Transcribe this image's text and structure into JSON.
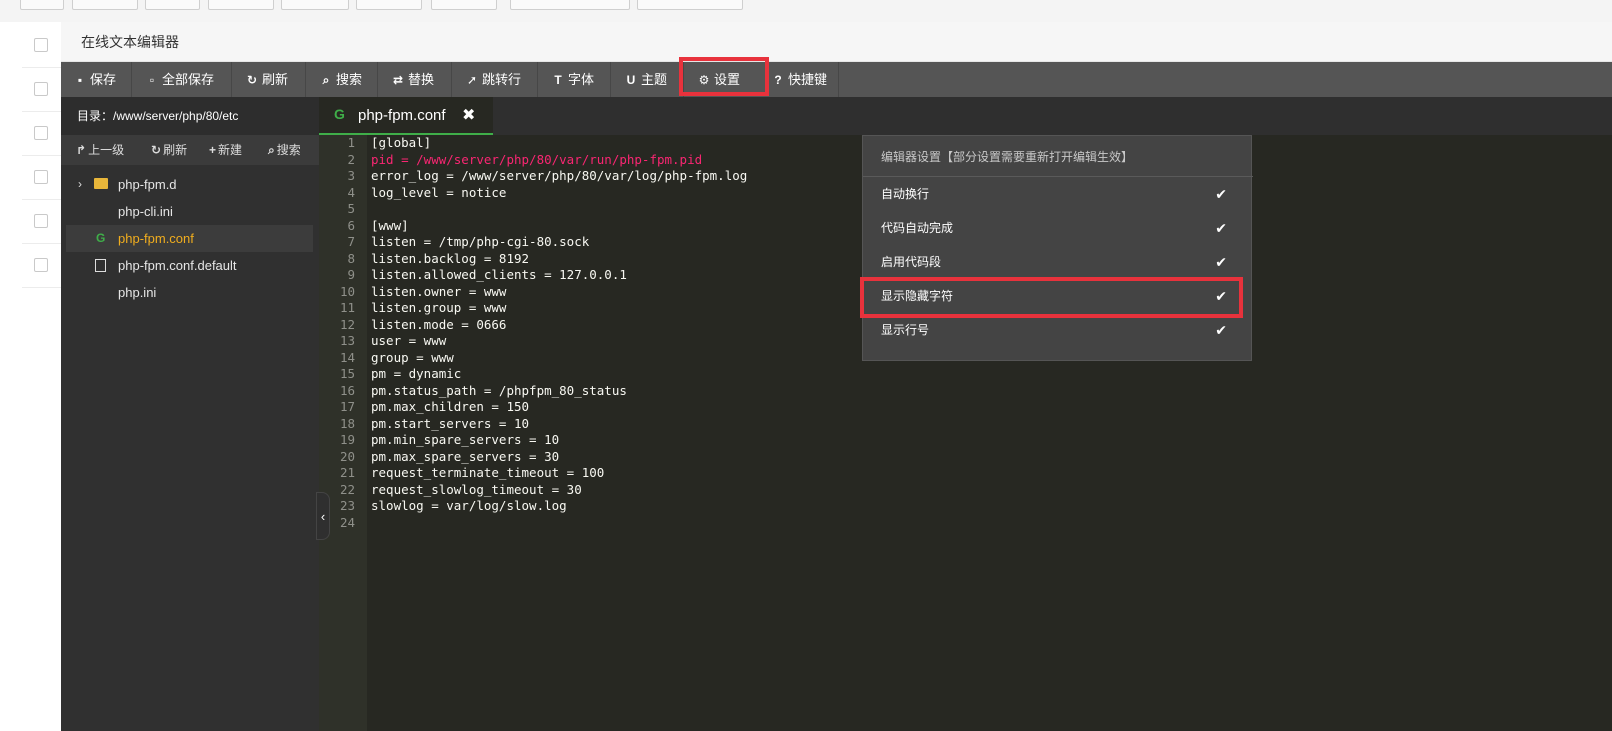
{
  "dialog": {
    "title": "在线文本编辑器"
  },
  "toolbar": {
    "items": [
      {
        "label": "保存",
        "icon": "save-icon",
        "glyph": "▪"
      },
      {
        "label": "全部保存",
        "icon": "save-all-icon",
        "glyph": "▫"
      },
      {
        "label": "刷新",
        "icon": "refresh-icon",
        "glyph": "↻"
      },
      {
        "label": "搜索",
        "icon": "search-icon",
        "glyph": "⌕"
      },
      {
        "label": "替换",
        "icon": "replace-icon",
        "glyph": "⇄"
      },
      {
        "label": "跳转行",
        "icon": "jump-icon",
        "glyph": "➚"
      },
      {
        "label": "字体",
        "icon": "font-icon",
        "glyph": "T"
      },
      {
        "label": "主题",
        "icon": "theme-icon",
        "glyph": "U"
      },
      {
        "label": "设置",
        "icon": "gear-icon",
        "glyph": "⚙"
      },
      {
        "label": "快捷键",
        "icon": "help-icon",
        "glyph": "?"
      }
    ]
  },
  "sidebar": {
    "path": "目录：/www/server/php/80/etc",
    "actions": [
      {
        "label": "上一级",
        "glyph": "↱"
      },
      {
        "label": "刷新",
        "glyph": "↻"
      },
      {
        "label": "新建",
        "glyph": "+"
      },
      {
        "label": "搜索",
        "glyph": "⌕"
      }
    ],
    "files": [
      {
        "name": "php-fpm.d",
        "type": "folder"
      },
      {
        "name": "php-cli.ini",
        "type": "file"
      },
      {
        "name": "php-fpm.conf",
        "type": "file-active"
      },
      {
        "name": "php-fpm.conf.default",
        "type": "doc"
      },
      {
        "name": "php.ini",
        "type": "file"
      }
    ]
  },
  "tab": {
    "label": "php-fpm.conf",
    "icon_glyph": "G",
    "close_glyph": "✖"
  },
  "code": {
    "line_numbers": [
      "1",
      "2",
      "3",
      "4",
      "5",
      "6",
      "7",
      "8",
      "9",
      "10",
      "11",
      "12",
      "13",
      "14",
      "15",
      "16",
      "17",
      "18",
      "19",
      "20",
      "21",
      "22",
      "23",
      "24"
    ],
    "lines": [
      "[global]",
      "pid = /www/server/php/80/var/run/php-fpm.pid",
      "error_log = /www/server/php/80/var/log/php-fpm.log",
      "log_level = notice",
      "",
      "[www]",
      "listen = /tmp/php-cgi-80.sock",
      "listen.backlog = 8192",
      "listen.allowed_clients = 127.0.0.1",
      "listen.owner = www",
      "listen.group = www",
      "listen.mode = 0666",
      "user = www",
      "group = www",
      "pm = dynamic",
      "pm.status_path = /phpfpm_80_status",
      "pm.max_children = 150",
      "pm.start_servers = 10",
      "pm.min_spare_servers = 10",
      "pm.max_spare_servers = 30",
      "request_terminate_timeout = 100",
      "request_slowlog_timeout = 30",
      "slowlog = var/log/slow.log",
      ""
    ]
  },
  "settings_panel": {
    "title": "编辑器设置【部分设置需要重新打开编辑生效】",
    "options": [
      {
        "label": "自动换行",
        "checked": true
      },
      {
        "label": "代码自动完成",
        "checked": true
      },
      {
        "label": "启用代码段",
        "checked": true
      },
      {
        "label": "显示隐藏字符",
        "checked": true
      },
      {
        "label": "显示行号",
        "checked": true
      }
    ],
    "check_glyph": "✔"
  },
  "colors": {
    "active_file": "#f0ad1e",
    "tab_indicator": "#3fae49",
    "highlight_box": "#e8323c",
    "keyword_pid": "#f92672"
  }
}
